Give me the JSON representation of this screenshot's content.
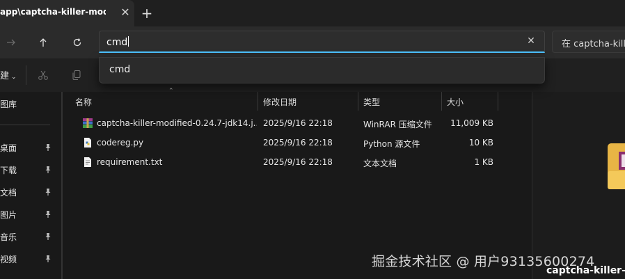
{
  "tab": {
    "title": "app\\captcha-killer-modifie",
    "close_icon": "close-icon",
    "new_tab_icon": "plus-icon"
  },
  "nav": {
    "back_icon": "arrow-left-icon",
    "forward_icon": "arrow-right-icon",
    "up_icon": "arrow-up-icon",
    "refresh_icon": "refresh-icon"
  },
  "address": {
    "value": "cmd",
    "clear_icon": "close-icon"
  },
  "search": {
    "placeholder": "在 captcha-kille"
  },
  "suggestions": [
    {
      "label": "cmd"
    }
  ],
  "toolbar": {
    "new_label": "建",
    "cut_icon": "scissors-icon",
    "copy_icon": "copy-icon"
  },
  "sidebar": {
    "items": [
      {
        "label": "图库",
        "pinned": false
      },
      {
        "label": "桌面",
        "pinned": true
      },
      {
        "label": "下载",
        "pinned": true
      },
      {
        "label": "文档",
        "pinned": true
      },
      {
        "label": "图片",
        "pinned": true
      },
      {
        "label": "音乐",
        "pinned": true
      },
      {
        "label": "视频",
        "pinned": true
      }
    ]
  },
  "columns": {
    "name": "名称",
    "modified": "修改日期",
    "type": "类型",
    "size": "大小"
  },
  "files": [
    {
      "name": "captcha-killer-modified-0.24.7-jdk14.j...",
      "modified": "2025/9/16 22:18",
      "type": "WinRAR 压缩文件",
      "size": "11,009 KB",
      "icon": "archive-icon"
    },
    {
      "name": "codereg.py",
      "modified": "2025/9/16 22:18",
      "type": "Python 源文件",
      "size": "10 KB",
      "icon": "python-file-icon"
    },
    {
      "name": "requirement.txt",
      "modified": "2025/9/16 22:18",
      "type": "文本文档",
      "size": "1 KB",
      "icon": "text-file-icon"
    }
  ],
  "preview": {
    "filename": "captcha-killer-m",
    "icon": "archive-icon"
  },
  "watermark": "掘金技术社区 @ 用户93135600274",
  "colors": {
    "accent": "#4cc2ff",
    "background": "#191919"
  }
}
